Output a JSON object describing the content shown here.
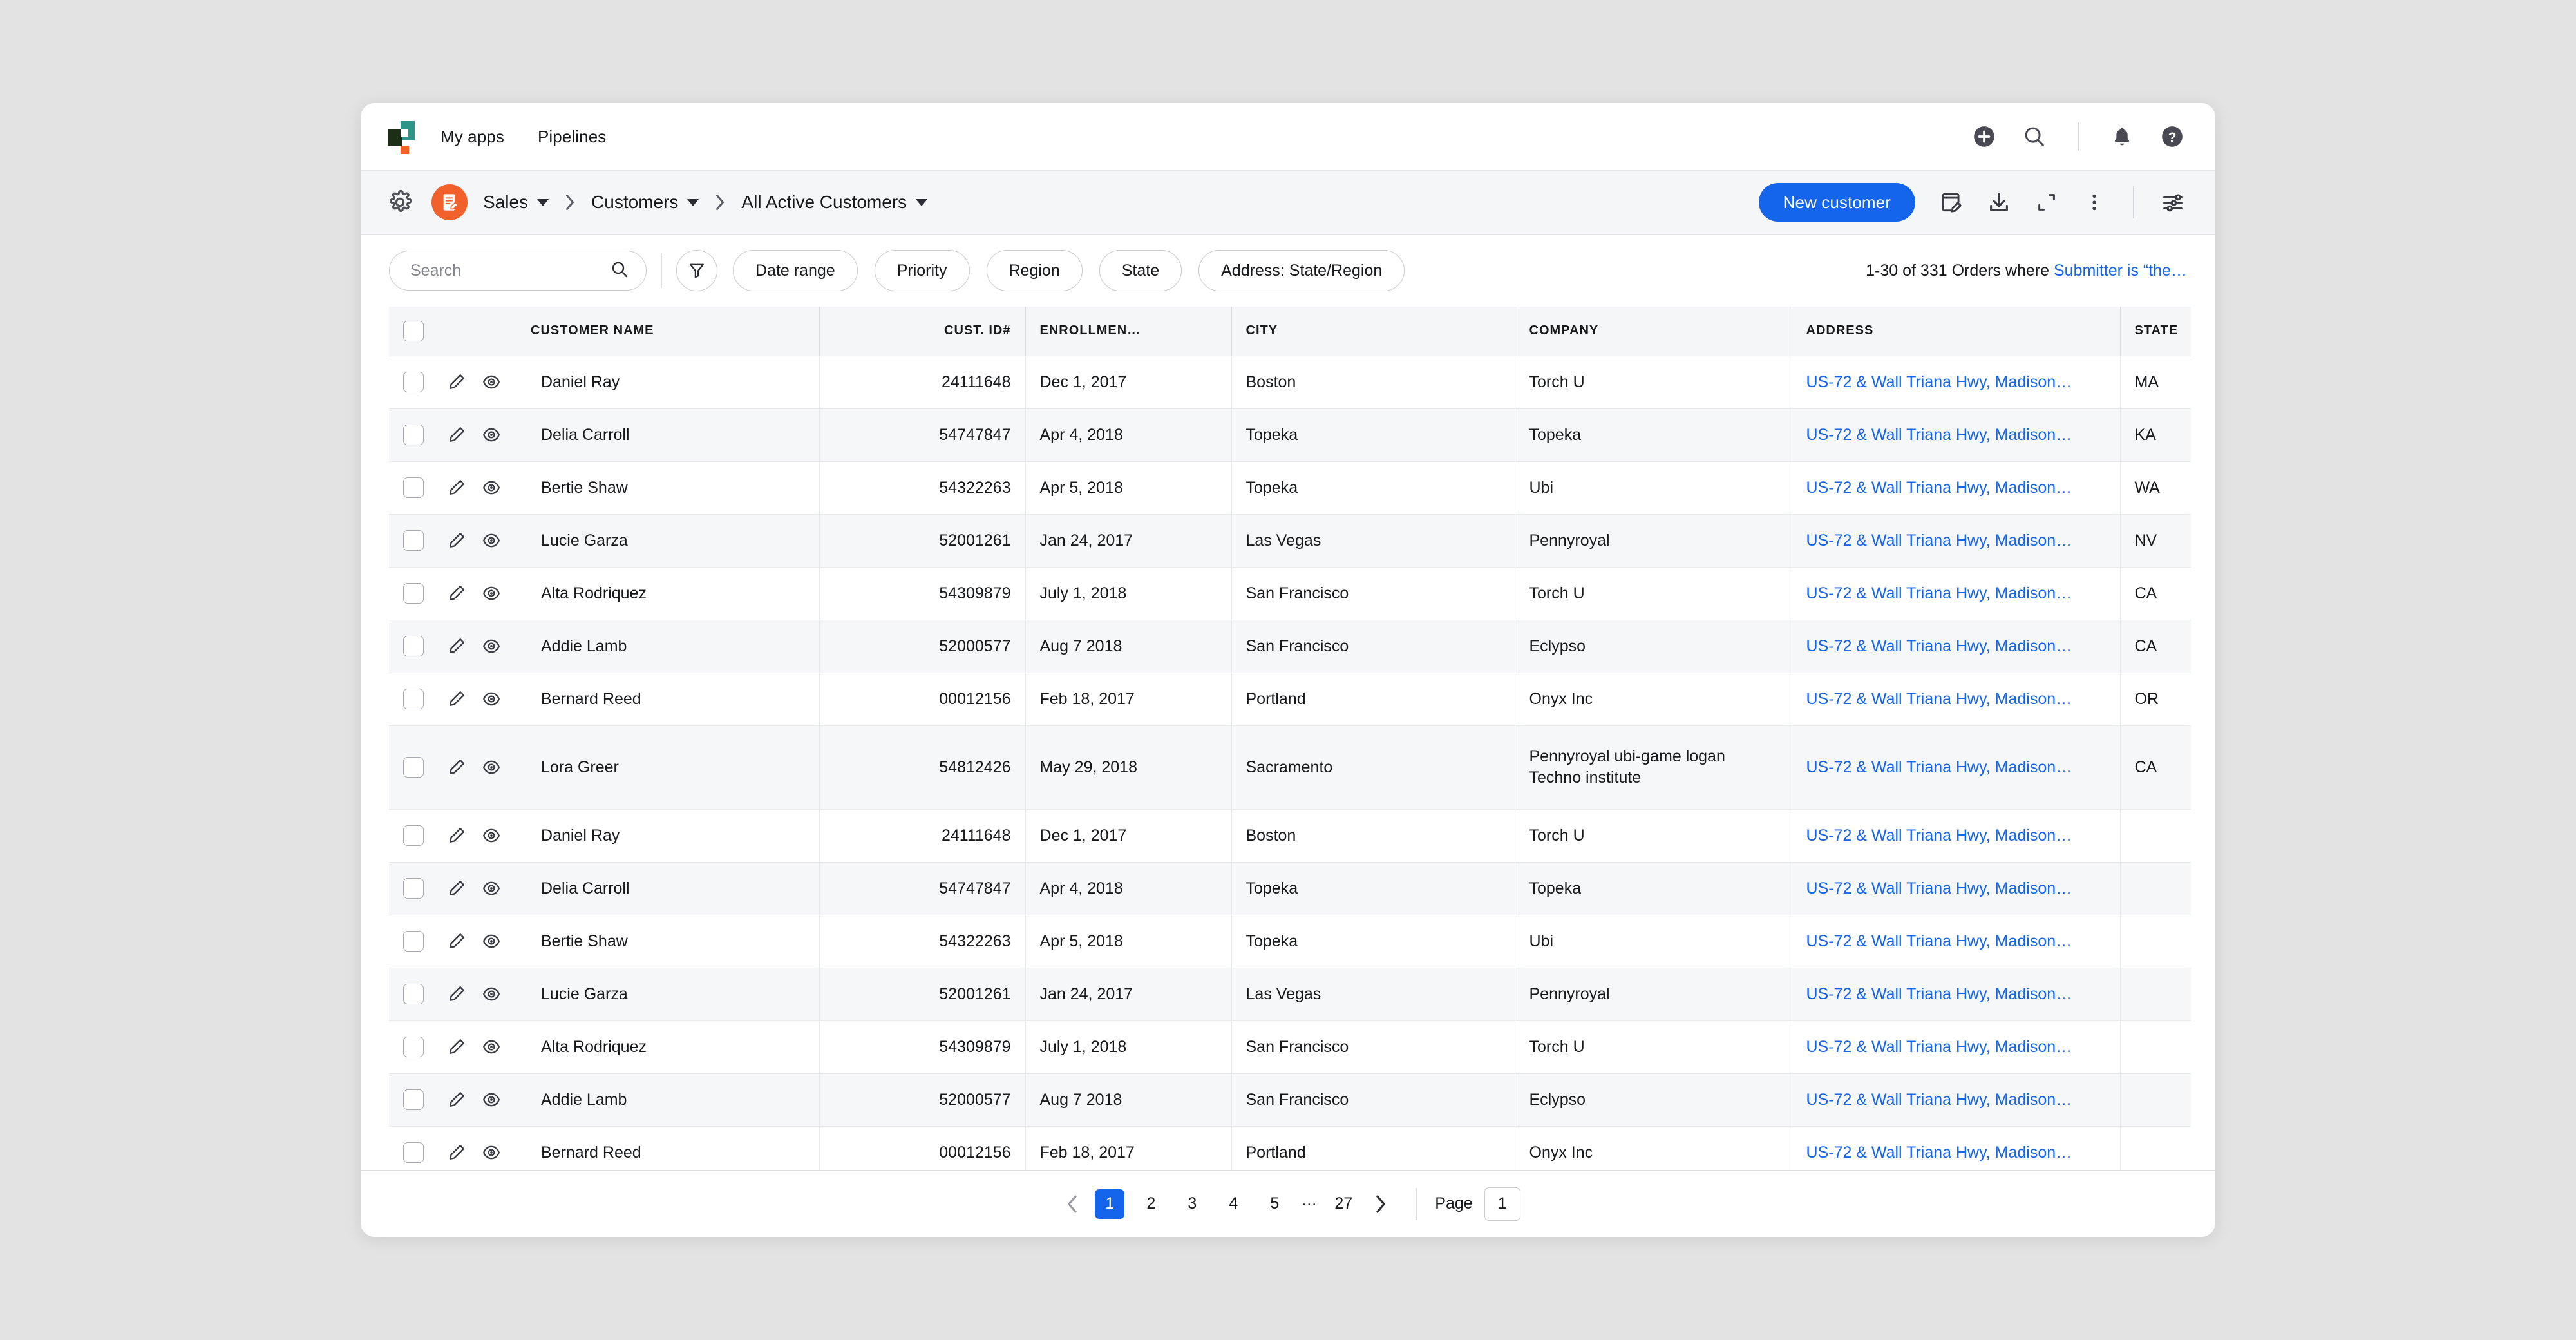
{
  "topnav": {
    "logo_name": "app-logo",
    "links": [
      {
        "label": "My apps"
      },
      {
        "label": "Pipelines"
      }
    ],
    "icons": [
      {
        "name": "add-circle-icon",
        "label": "Add"
      },
      {
        "name": "search-icon",
        "label": "Search"
      },
      {
        "name": "bell-icon",
        "label": "Notifications"
      },
      {
        "name": "help-icon",
        "label": "Help"
      }
    ]
  },
  "toolbar": {
    "gear_label": "Settings",
    "app_badge_name": "sales-app-icon",
    "breadcrumb": [
      {
        "label": "Sales",
        "has_caret": true
      },
      {
        "label": "Customers",
        "has_caret": true
      },
      {
        "label": "All Active Customers",
        "has_caret": true
      }
    ],
    "primary_button": "New customer",
    "actions": [
      {
        "name": "edit-record-icon",
        "label": "Edit"
      },
      {
        "name": "download-icon",
        "label": "Download"
      },
      {
        "name": "expand-icon",
        "label": "Expand"
      },
      {
        "name": "more-vertical-icon",
        "label": "More"
      },
      {
        "name": "settings-sliders-icon",
        "label": "View settings"
      }
    ]
  },
  "filterbar": {
    "search_placeholder": "Search",
    "search_value": "",
    "funnel_label": "Filter",
    "chips": [
      {
        "label": "Date range"
      },
      {
        "label": "Priority"
      },
      {
        "label": "Region"
      },
      {
        "label": "State"
      },
      {
        "label": "Address: State/Region"
      }
    ],
    "result_text": "1-30 of 331 Orders where ",
    "result_link": "Submitter is “the…",
    "link_color": "#1464ec"
  },
  "table": {
    "columns": [
      "CUSTOMER NAME",
      "CUST. ID#",
      "ENROLLMEN…",
      "CITY",
      "COMPANY",
      "ADDRESS",
      "STATE"
    ],
    "rows": [
      {
        "name": "Daniel Ray",
        "id": "24111648",
        "enrolled": "Dec 1, 2017",
        "city": "Boston",
        "company": "Torch U",
        "address": "US-72 & Wall Triana Hwy, Madison…",
        "state": "MA"
      },
      {
        "name": "Delia Carroll",
        "id": "54747847",
        "enrolled": "Apr 4, 2018",
        "city": "Topeka",
        "company": "Topeka",
        "address": "US-72 & Wall Triana Hwy, Madison…",
        "state": "KA"
      },
      {
        "name": "Bertie Shaw",
        "id": "54322263",
        "enrolled": "Apr 5, 2018",
        "city": "Topeka",
        "company": "Ubi",
        "address": "US-72 & Wall Triana Hwy, Madison…",
        "state": "WA"
      },
      {
        "name": "Lucie Garza",
        "id": "52001261",
        "enrolled": "Jan 24, 2017",
        "city": "Las Vegas",
        "company": "Pennyroyal",
        "address": "US-72 & Wall Triana Hwy, Madison…",
        "state": "NV"
      },
      {
        "name": "Alta Rodriquez",
        "id": "54309879",
        "enrolled": "July 1, 2018",
        "city": "San Francisco",
        "company": "Torch U",
        "address": "US-72 & Wall Triana Hwy, Madison…",
        "state": "CA"
      },
      {
        "name": "Addie Lamb",
        "id": "52000577",
        "enrolled": "Aug 7 2018",
        "city": "San Francisco",
        "company": "Eclypso",
        "address": "US-72 & Wall Triana Hwy, Madison…",
        "state": "CA"
      },
      {
        "name": "Bernard Reed",
        "id": "00012156",
        "enrolled": "Feb 18, 2017",
        "city": "Portland",
        "company": "Onyx Inc",
        "address": "US-72 & Wall Triana Hwy, Madison…",
        "state": "OR"
      },
      {
        "name": "Lora Greer",
        "id": "54812426",
        "enrolled": "May 29, 2018",
        "city": "Sacramento",
        "company": "Pennyroyal ubi-game logan Techno institute",
        "address": "US-72 & Wall Triana Hwy, Madison…",
        "state": "CA",
        "tall": true
      },
      {
        "name": "Daniel Ray",
        "id": "24111648",
        "enrolled": "Dec 1, 2017",
        "city": "Boston",
        "company": "Torch U",
        "address": "US-72 & Wall Triana Hwy, Madison…",
        "state": ""
      },
      {
        "name": "Delia Carroll",
        "id": "54747847",
        "enrolled": "Apr 4, 2018",
        "city": "Topeka",
        "company": "Topeka",
        "address": "US-72 & Wall Triana Hwy, Madison…",
        "state": ""
      },
      {
        "name": "Bertie Shaw",
        "id": "54322263",
        "enrolled": "Apr 5, 2018",
        "city": "Topeka",
        "company": "Ubi",
        "address": "US-72 & Wall Triana Hwy, Madison…",
        "state": ""
      },
      {
        "name": "Lucie Garza",
        "id": "52001261",
        "enrolled": "Jan 24, 2017",
        "city": "Las Vegas",
        "company": "Pennyroyal",
        "address": "US-72 & Wall Triana Hwy, Madison…",
        "state": ""
      },
      {
        "name": "Alta Rodriquez",
        "id": "54309879",
        "enrolled": "July 1, 2018",
        "city": "San Francisco",
        "company": "Torch U",
        "address": "US-72 & Wall Triana Hwy, Madison…",
        "state": ""
      },
      {
        "name": "Addie Lamb",
        "id": "52000577",
        "enrolled": "Aug 7 2018",
        "city": "San Francisco",
        "company": "Eclypso",
        "address": "US-72 & Wall Triana Hwy, Madison…",
        "state": ""
      },
      {
        "name": "Bernard Reed",
        "id": "00012156",
        "enrolled": "Feb 18, 2017",
        "city": "Portland",
        "company": "Onyx Inc",
        "address": "US-72 & Wall Triana Hwy, Madison…",
        "state": ""
      }
    ]
  },
  "pagination": {
    "prev_label": "Previous page",
    "next_label": "Next page",
    "pages": [
      "1",
      "2",
      "3",
      "4",
      "5",
      "…",
      "27"
    ],
    "active_page": "1",
    "page_label": "Page",
    "page_input_value": "1"
  },
  "colors": {
    "accent_blue": "#1464ec",
    "brand_orange": "#f2612c",
    "brand_teal": "#2e9688",
    "brand_dark": "#1d2e17",
    "header_bg": "#f5f6f8",
    "stripe_bg": "#f6f7f9",
    "page_bg": "#e3e3e3"
  }
}
